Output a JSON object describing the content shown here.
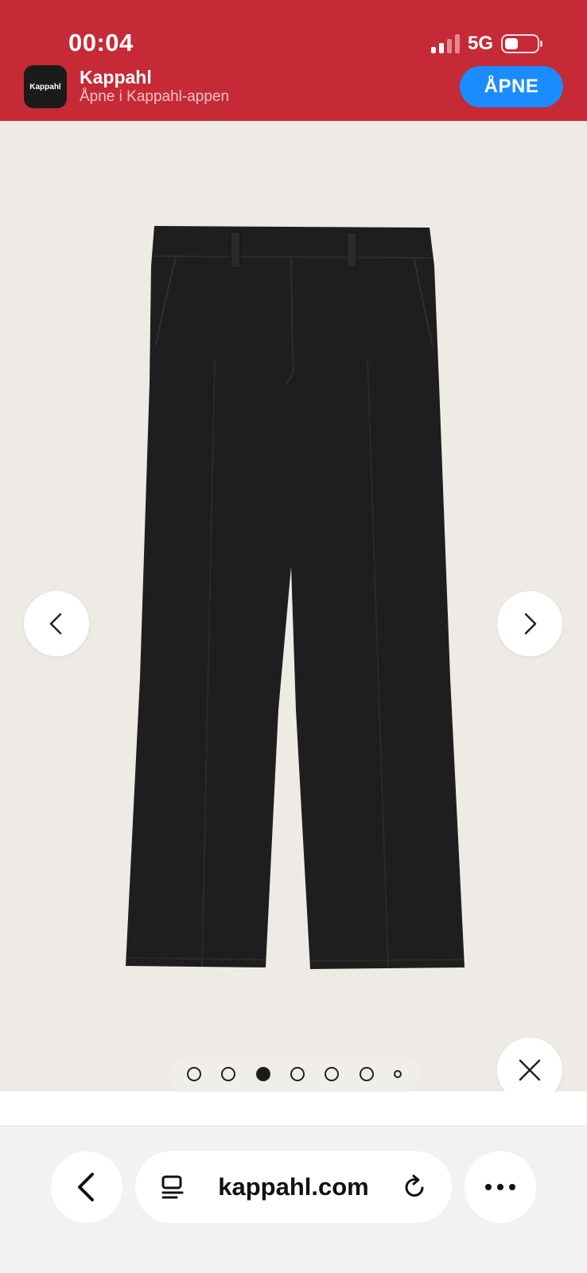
{
  "status_bar": {
    "time": "00:04",
    "network": "5G",
    "signal_bars_active": 2,
    "battery_level": 0.3
  },
  "app_banner": {
    "icon_text": "Kappahl",
    "app_name": "Kappahl",
    "subtitle": "Åpne i Kappahl-appen",
    "open_label": "ÅPNE"
  },
  "gallery": {
    "image_alt": "black flared trousers",
    "dots_total": 7,
    "active_index": 2,
    "icons": {
      "prev": "chevron-left-icon",
      "next": "chevron-right-icon",
      "close": "close-icon"
    }
  },
  "browser": {
    "url": "kappahl.com",
    "icons": {
      "back": "back-arrow-icon",
      "tabs": "tab-overview-icon",
      "reload": "reload-icon",
      "more": "more-icon"
    }
  },
  "colors": {
    "banner_bg": "#c62a36",
    "open_button": "#1a8cff",
    "gallery_bg": "#eeebe6"
  }
}
